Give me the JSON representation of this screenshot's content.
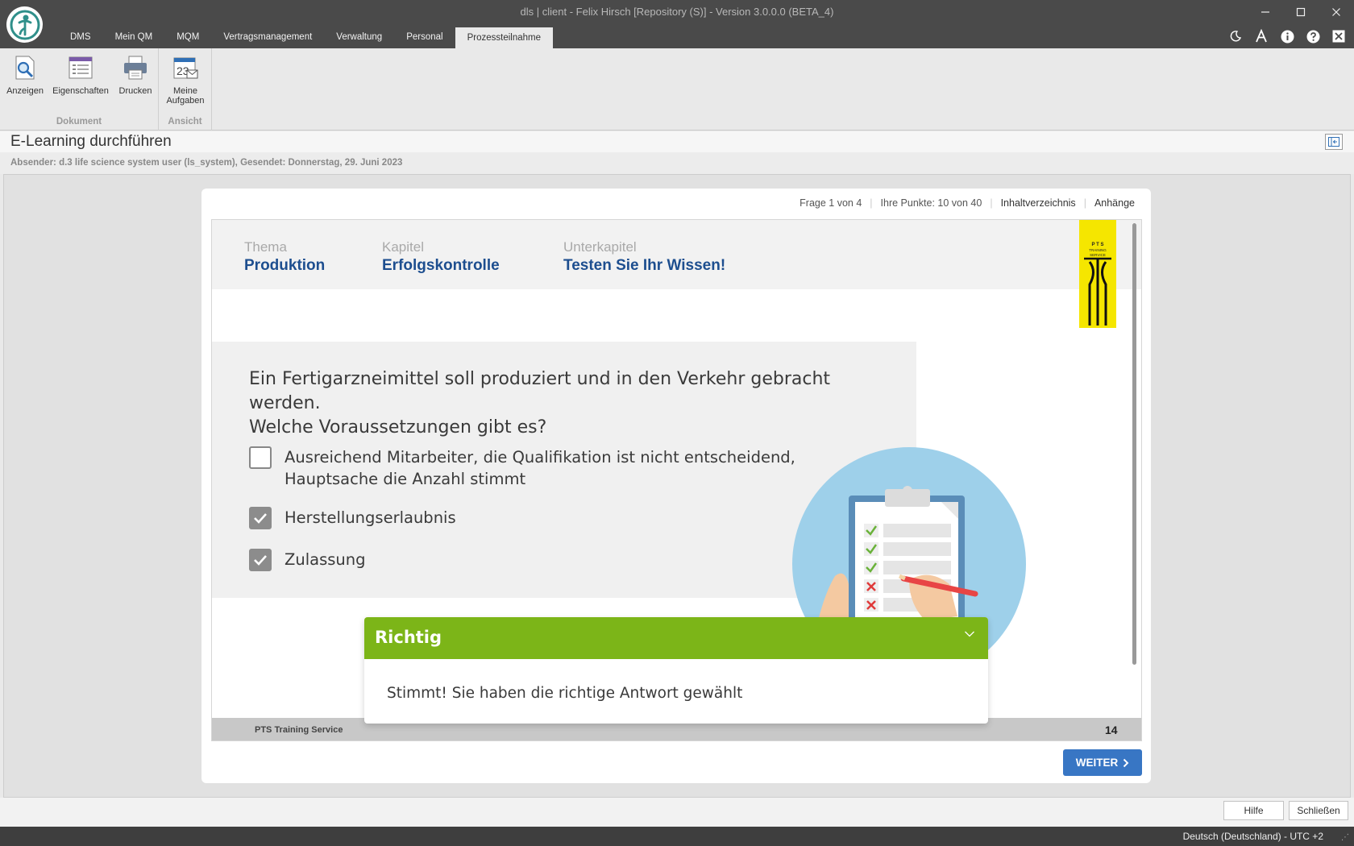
{
  "window": {
    "title": "dls | client - Felix Hirsch [Repository (S)] - Version 3.0.0.0 (BETA_4)",
    "controls": [
      "minimize-icon",
      "maximize-icon",
      "close-icon"
    ]
  },
  "menu": {
    "items": [
      "DMS",
      "Mein QM",
      "MQM",
      "Vertragsmanagement",
      "Verwaltung",
      "Personal",
      "Prozessteilnahme"
    ],
    "active": "Prozessteilnahme"
  },
  "quick_icons": [
    "moon-icon",
    "font-size-icon",
    "info-icon",
    "help-icon",
    "close-session-icon"
  ],
  "ribbon": {
    "groups": [
      {
        "label": "Dokument",
        "buttons": [
          {
            "label": "Anzeigen",
            "icon": "magnifier-document-icon"
          },
          {
            "label": "Eigenschaften",
            "icon": "properties-icon"
          },
          {
            "label": "Drucken",
            "icon": "printer-icon"
          }
        ]
      },
      {
        "label": "Ansicht",
        "buttons": [
          {
            "label_line1": "Meine",
            "label_line2": "Aufgaben",
            "icon": "calendar-tasks-icon"
          }
        ]
      }
    ]
  },
  "panel": {
    "title": "E-Learning durchführen",
    "sender": "Absender: d.3 life science system user (ls_system), Gesendet: Donnerstag, 29. Juni 2023"
  },
  "player": {
    "question_counter": "Frage 1 von 4",
    "points": "Ihre Punkte: 10 von 40",
    "toc_link": "Inhaltverzeichnis",
    "attachments_link": "Anhänge",
    "next_button": "WEITER"
  },
  "slide": {
    "topic_label": "Thema",
    "topic": "Produktion",
    "chapter_label": "Kapitel",
    "chapter": "Erfolgskontrolle",
    "subchapter_label": "Unterkapitel",
    "subchapter": "Testen Sie Ihr Wissen!",
    "logo_text": [
      "P T S",
      "TRAINING",
      "SERVICE"
    ],
    "question_line1": "Ein Fertigarzneimittel soll produziert und in den Verkehr gebracht werden.",
    "question_line2": "Welche Voraussetzungen gibt es?",
    "options": [
      {
        "line1": "Ausreichend Mitarbeiter, die Qualifikation ist nicht entscheidend,",
        "line2": "Hauptsache die Anzahl stimmt",
        "checked": false
      },
      {
        "line1": "Herstellungserlaubnis",
        "checked": true
      },
      {
        "line1": "Zulassung",
        "checked": true
      }
    ],
    "footer_brand": "PTS Training Service",
    "page_number": "14"
  },
  "feedback": {
    "title": "Richtig",
    "message": "Stimmt! Sie haben die richtige Antwort gewählt",
    "color": "#7cb518"
  },
  "bottom": {
    "help": "Hilfe",
    "close": "Schließen"
  },
  "status": {
    "locale": "Deutsch (Deutschland) - UTC +2"
  },
  "colors": {
    "titlebar": "#4a4a4a",
    "accent_blue": "#3876c4",
    "heading_blue": "#1d4e8f",
    "logo_yellow": "#f5e600"
  }
}
